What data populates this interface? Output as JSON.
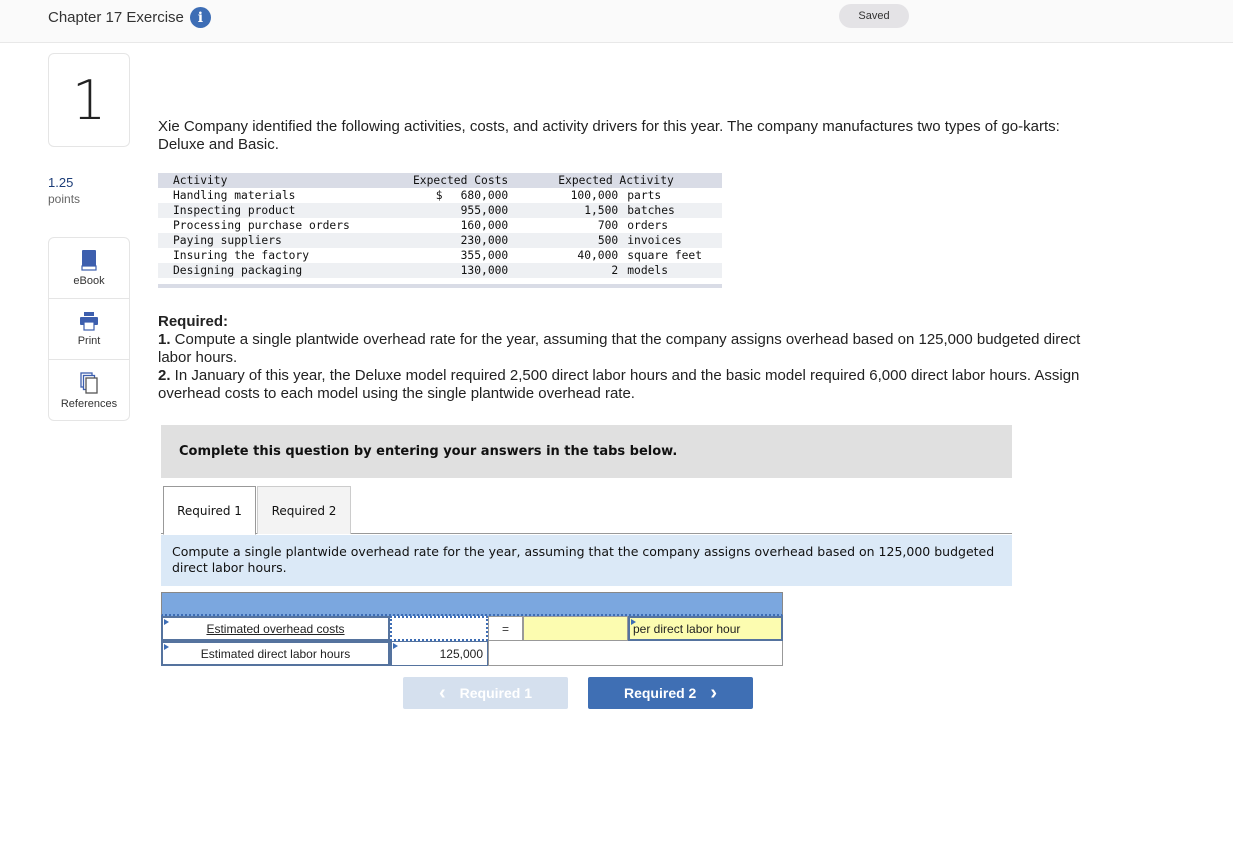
{
  "header": {
    "title": "Chapter 17 Exercise",
    "info_icon": "info-icon",
    "saved_label": "Saved"
  },
  "question": {
    "number": "1",
    "points_value": "1.25",
    "points_label": "points"
  },
  "tools": [
    {
      "label": "eBook",
      "icon": "book-icon"
    },
    {
      "label": "Print",
      "icon": "printer-icon"
    },
    {
      "label": "References",
      "icon": "documents-icon"
    }
  ],
  "intro": "Xie Company identified the following activities, costs, and activity drivers for this year. The company manufactures two types of go-karts: Deluxe and Basic.",
  "activity_table": {
    "headers": {
      "activity": "Activity",
      "costs": "Expected Costs",
      "expected_activity": "Expected Activity"
    },
    "rows": [
      {
        "activity": "Handling materials",
        "cost_symbol": "$",
        "cost": "680,000",
        "qty": "100,000",
        "unit": "parts"
      },
      {
        "activity": "Inspecting product",
        "cost_symbol": "",
        "cost": "955,000",
        "qty": "1,500",
        "unit": "batches"
      },
      {
        "activity": "Processing purchase orders",
        "cost_symbol": "",
        "cost": "160,000",
        "qty": "700",
        "unit": "orders"
      },
      {
        "activity": "Paying suppliers",
        "cost_symbol": "",
        "cost": "230,000",
        "qty": "500",
        "unit": "invoices"
      },
      {
        "activity": "Insuring the factory",
        "cost_symbol": "",
        "cost": "355,000",
        "qty": "40,000",
        "unit": "square feet"
      },
      {
        "activity": "Designing packaging",
        "cost_symbol": "",
        "cost": "130,000",
        "qty": "2",
        "unit": "models"
      }
    ]
  },
  "required": {
    "heading": "Required:",
    "item1_num": "1.",
    "item1_text": " Compute a single plantwide overhead rate for the year, assuming that the company assigns overhead based on 125,000 budgeted direct labor hours.",
    "item2_num": "2.",
    "item2_text": " In January of this year, the Deluxe model required 2,500 direct labor hours and the basic model required 6,000 direct labor hours. Assign overhead costs to each model using the single plantwide overhead rate."
  },
  "banner": "Complete this question by entering your answers in the tabs below.",
  "tabs": [
    {
      "label": "Required 1",
      "active": true
    },
    {
      "label": "Required 2",
      "active": false
    }
  ],
  "tab_prompt": "Compute a single plantwide overhead rate for the year, assuming that the company assigns overhead based on 125,000 budgeted direct labor hours.",
  "worksheet": {
    "row1_label": "Estimated overhead costs",
    "row1_value": "",
    "equals": "=",
    "answer_value": "",
    "unit_label": "per direct labor hour",
    "row2_label": "Estimated direct labor hours",
    "row2_value": "125,000"
  },
  "nav": {
    "prev_label": "Required 1",
    "next_label": "Required 2",
    "prev_icon": "‹",
    "next_icon": "›"
  }
}
